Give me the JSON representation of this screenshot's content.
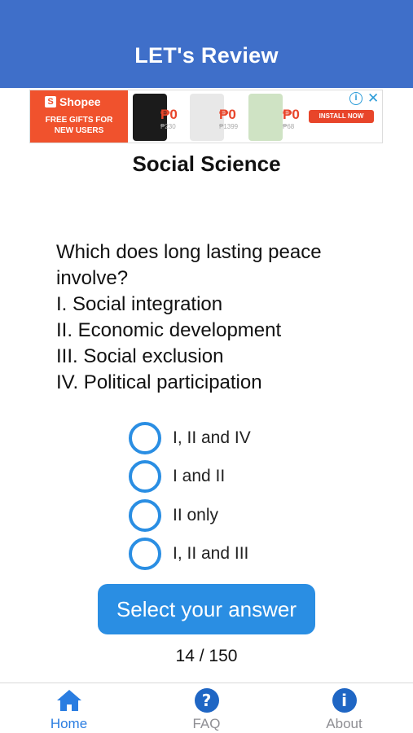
{
  "header": {
    "title": "LET's Review"
  },
  "ad": {
    "brand": "Shopee",
    "promo": "FREE GIFTS FOR NEW USERS",
    "items": [
      {
        "price": "₱0",
        "old_price": "₱230"
      },
      {
        "price": "₱0",
        "old_price": "₱1399"
      },
      {
        "price": "₱0",
        "old_price": "₱68"
      }
    ],
    "install_label": "INSTALL NOW",
    "info_icon": "i",
    "close_icon": "✕"
  },
  "subject": "Social Science",
  "question": {
    "lines": [
      "Which does long lasting peace",
      "involve?",
      "I. Social integration",
      "II. Economic development",
      "III. Social exclusion",
      "IV. Political participation"
    ]
  },
  "options": [
    {
      "label": "I, II and IV"
    },
    {
      "label": "I and II"
    },
    {
      "label": "II only"
    },
    {
      "label": "I, II and III"
    }
  ],
  "submit_label": "Select your answer",
  "progress": "14 / 150",
  "tabs": [
    {
      "label": "Home",
      "icon": "home-icon",
      "active": true
    },
    {
      "label": "FAQ",
      "icon": "question-circle-icon",
      "active": false
    },
    {
      "label": "About",
      "icon": "info-circle-icon",
      "active": false
    }
  ],
  "colors": {
    "header": "#3f6fc9",
    "accent": "#2a8ee3",
    "tab_active": "#2a7de1",
    "tab_icon": "#1f66c4"
  }
}
